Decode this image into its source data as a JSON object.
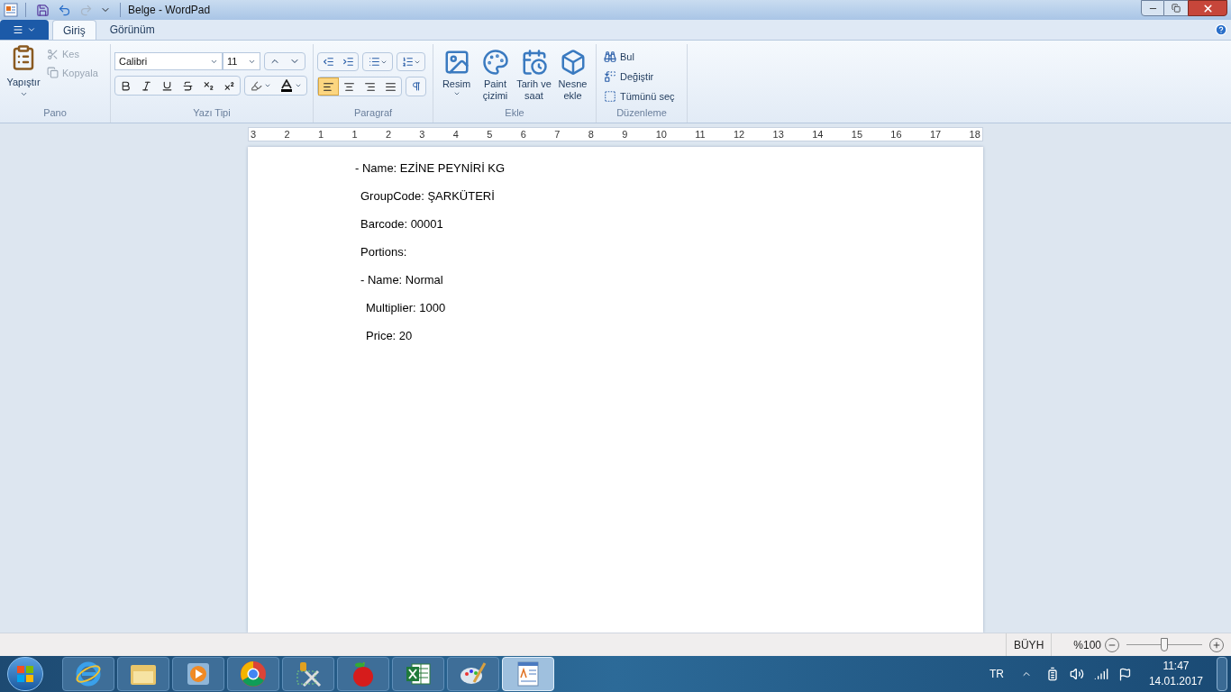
{
  "window": {
    "title": "Belge - WordPad"
  },
  "quick_access": [
    {
      "kind": "save",
      "disabled": false
    },
    {
      "kind": "undo",
      "disabled": false
    },
    {
      "kind": "redo",
      "disabled": true
    }
  ],
  "tabs": [
    {
      "label": "Giriş",
      "selected": true
    },
    {
      "label": "Görünüm",
      "selected": false
    }
  ],
  "clipboard": {
    "group": "Pano",
    "paste": "Yapıştır",
    "cut": {
      "label": "Kes",
      "disabled": true
    },
    "copy": {
      "label": "Kopyala",
      "disabled": true
    }
  },
  "font": {
    "group": "Yazı Tipi",
    "family": "Calibri",
    "size": "11"
  },
  "paragraph": {
    "group": "Paragraf",
    "alignments": [
      {
        "kind": "left",
        "selected": true
      },
      {
        "kind": "center",
        "selected": false
      },
      {
        "kind": "right",
        "selected": false
      },
      {
        "kind": "justify",
        "selected": false
      }
    ]
  },
  "insert": {
    "group": "Ekle",
    "items": [
      {
        "kind": "picture",
        "label": "Resim",
        "dropdown": true
      },
      {
        "kind": "paint",
        "label": "Paint çizimi",
        "dropdown": false
      },
      {
        "kind": "datetime",
        "label": "Tarih ve saat",
        "dropdown": false
      },
      {
        "kind": "object",
        "label": "Nesne ekle",
        "dropdown": false
      }
    ]
  },
  "editing": {
    "group": "Düzenleme",
    "items": [
      {
        "kind": "find",
        "label": "Bul"
      },
      {
        "kind": "replace",
        "label": "Değiştir"
      },
      {
        "kind": "selectall",
        "label": "Tümünü seç"
      }
    ]
  },
  "ruler": {
    "ticks": [
      "3",
      "2",
      "1",
      "1",
      "2",
      "3",
      "4",
      "5",
      "6",
      "7",
      "8",
      "9",
      "10",
      "11",
      "12",
      "13",
      "14",
      "15",
      "16",
      "17",
      "18"
    ]
  },
  "document": {
    "lines": [
      {
        "text": "- Name: EZİNE PEYNİRİ KG",
        "children": [
          {
            "text": "GroupCode: ŞARKÜTERİ"
          },
          {
            "text": "Barcode: 00001"
          },
          {
            "text": "Portions:"
          },
          {
            "text": "- Name: Normal",
            "children": [
              {
                "text": "Multiplier: 1000"
              },
              {
                "text": "Price: 20"
              }
            ]
          }
        ]
      }
    ]
  },
  "status_bar": {
    "caps": "BÜYH",
    "zoom": "%100",
    "zoom_slider": {
      "level": 0.5
    }
  },
  "taskbar": {
    "apps": [
      {
        "kind": "ie",
        "selected": false
      },
      {
        "kind": "folder",
        "selected": false
      },
      {
        "kind": "media",
        "selected": false
      },
      {
        "kind": "chrome",
        "selected": false
      },
      {
        "kind": "tools",
        "selected": false
      },
      {
        "kind": "apple",
        "selected": false
      },
      {
        "kind": "excel",
        "selected": false
      },
      {
        "kind": "paint",
        "selected": false
      },
      {
        "kind": "wordpad",
        "selected": true
      }
    ],
    "language": "TR",
    "time": "11:47",
    "date": "14.01.2017"
  }
}
